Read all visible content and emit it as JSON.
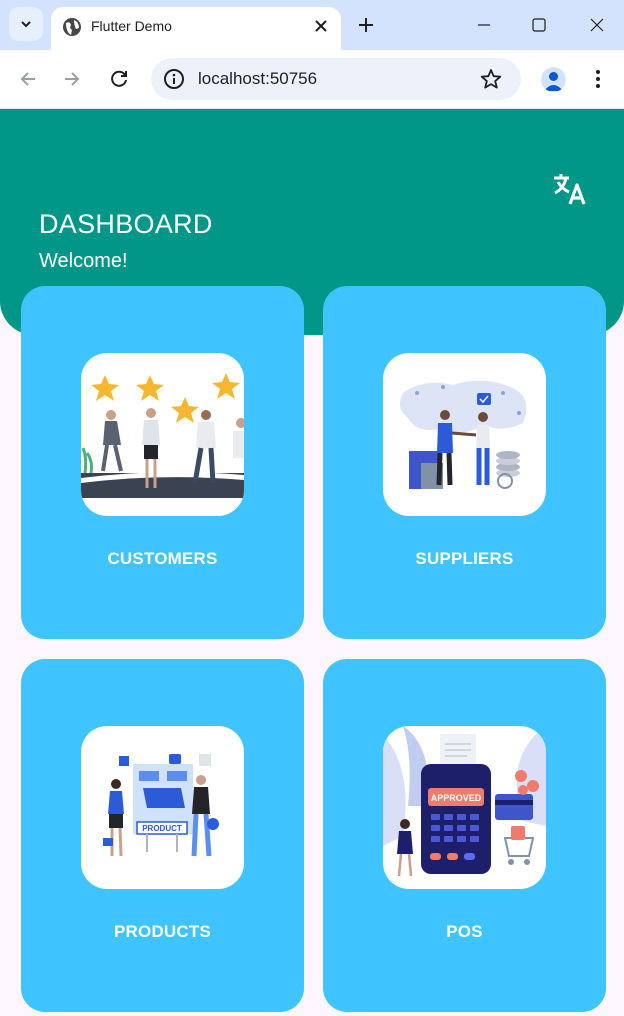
{
  "browser": {
    "tab_title": "Flutter Demo",
    "url": "localhost:50756",
    "icons": [
      "tab-search-icon",
      "globe-icon",
      "close-icon",
      "plus-icon",
      "minimize-icon",
      "maximize-icon",
      "close-window-icon",
      "back-arrow-icon",
      "forward-arrow-icon",
      "reload-icon",
      "site-info-icon",
      "star-icon",
      "profile-icon",
      "more-vert-icon"
    ]
  },
  "header": {
    "title": "DASHBOARD",
    "subtitle": "Welcome!",
    "translate_icon": "translate-icon",
    "color": "#009688"
  },
  "cards": [
    {
      "id": "customers",
      "label": "CUSTOMERS",
      "illustration": "customers-illustration"
    },
    {
      "id": "suppliers",
      "label": "SUPPLIERS",
      "illustration": "suppliers-illustration"
    },
    {
      "id": "products",
      "label": "PRODUCTS",
      "illustration": "products-illustration"
    },
    {
      "id": "pos",
      "label": "POS",
      "illustration": "pos-illustration",
      "illustration_text": "APPROVED"
    }
  ],
  "colors": {
    "card": "#40c4ff",
    "background": "#fdf6fc",
    "tabbar": "#d3e3fd"
  }
}
